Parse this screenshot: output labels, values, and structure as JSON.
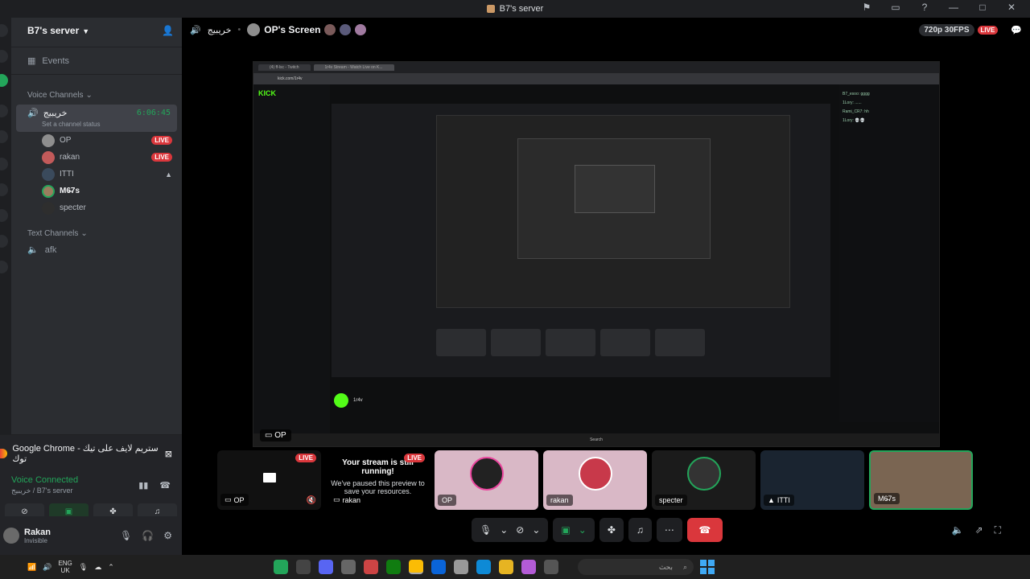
{
  "window": {
    "title": "B7's server"
  },
  "server": {
    "name": "B7's server",
    "events_label": "Events"
  },
  "sidebar": {
    "voice_category": "Voice Channels",
    "voice_channel": {
      "name": "خريبيج",
      "timer": "6:06:45",
      "status": "Set a channel status"
    },
    "members": [
      {
        "name": "OP",
        "live": "LIVE",
        "color": "#8e8e8e"
      },
      {
        "name": "rakan",
        "live": "LIVE",
        "color": "#c25a5a"
      },
      {
        "name": "ITTI",
        "live": "",
        "color": "#3a4a5c"
      },
      {
        "name": "M6̶7s",
        "live": "",
        "color": "#9a7d5e"
      },
      {
        "name": "specter",
        "live": "",
        "color": "#2e2e2e"
      }
    ],
    "text_category": "Text Channels",
    "text_channels": [
      {
        "name": "afk"
      }
    ]
  },
  "voice_panel": {
    "app": "Google Chrome - ستريم لايف على تيك توك",
    "connected": "Voice Connected",
    "location": "خريبيج / B7's server"
  },
  "user": {
    "name": "Rakan",
    "status": "Invisible"
  },
  "stage": {
    "channel": "خريبيج",
    "screen_title": "OP's Screen",
    "quality": "720p 30FPS",
    "live": "LIVE",
    "stream_label": "OP"
  },
  "stream_content": {
    "tab1": "(4) ff-lsc - Twitch",
    "tab2": "1r4v Stream - Watch Live on K...",
    "url": "kick.com/1r4v",
    "logo": "KICK",
    "streamer": "1r4v",
    "chat": [
      "B7_esoo: gggg",
      "1Lory: ......",
      "Rami_CR7: hh",
      "1Lory: 💀💀"
    ],
    "taskbar_search": "Search"
  },
  "tiles": [
    {
      "name": "OP",
      "live": "LIVE",
      "type": "screen"
    },
    {
      "name": "rakan",
      "live": "LIVE",
      "type": "message",
      "heading": "Your stream is still running!",
      "body": "We've paused this preview to save your resources."
    },
    {
      "name": "OP",
      "live": "",
      "type": "avatar"
    },
    {
      "name": "rakan",
      "live": "",
      "type": "avatar"
    },
    {
      "name": "specter",
      "live": "",
      "type": "avatar"
    },
    {
      "name": "ITTI",
      "live": "",
      "type": "video"
    },
    {
      "name": "M6̶7s",
      "live": "",
      "type": "video"
    }
  ],
  "taskbar": {
    "lang_top": "ENG",
    "lang_bottom": "UK",
    "search": "بحث"
  },
  "colors": {
    "accent_green": "#23a55a",
    "live_red": "#da373c",
    "bg": "#2b2d31"
  }
}
